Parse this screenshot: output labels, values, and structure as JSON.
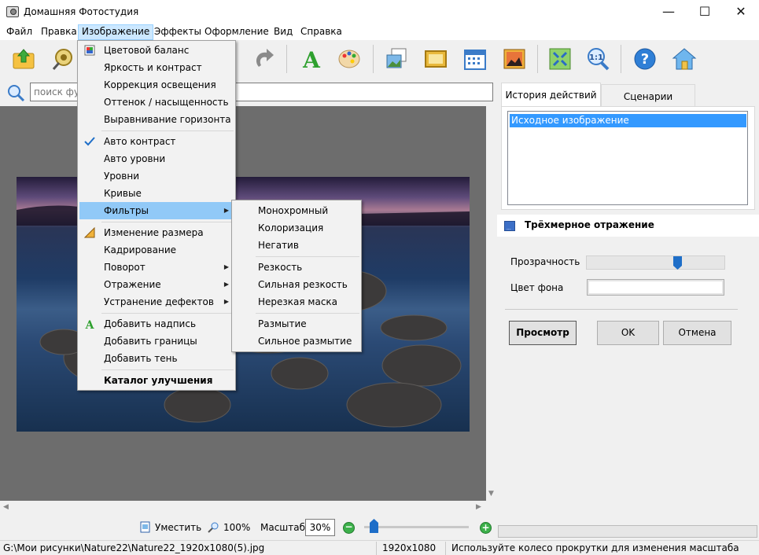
{
  "window": {
    "title": "Домашняя Фотостудия",
    "controls": [
      "—",
      "☐",
      "✕"
    ]
  },
  "menubar": [
    "Файл",
    "Правка",
    "Изображение",
    "Эффекты",
    "Оформление",
    "Вид",
    "Справка"
  ],
  "search": {
    "placeholder": "поиск фу"
  },
  "image_menu": {
    "items": [
      "Цветовой баланс",
      "Яркость и контраст",
      "Коррекция освещения",
      "Оттенок / насыщенность",
      "Выравнивание горизонта",
      "Авто контраст",
      "Авто уровни",
      "Уровни",
      "Кривые",
      "Фильтры",
      "Изменение размера",
      "Кадрирование",
      "Поворот",
      "Отражение",
      "Устранение дефектов",
      "Добавить надпись",
      "Добавить границы",
      "Добавить тень",
      "Каталог улучшения"
    ]
  },
  "filters_submenu": {
    "items": [
      "Монохромный",
      "Колоризация",
      "Негатив",
      "Резкость",
      "Сильная резкость",
      "Нерезкая маска",
      "Размытие",
      "Сильное размытие"
    ]
  },
  "right_panel": {
    "tabs": [
      "История действий",
      "Сценарии"
    ],
    "history": [
      "Исходное изображение"
    ],
    "effect_title": "Трёхмерное отражение",
    "transparency_label": "Прозрачность",
    "transparency_value": 0.67,
    "bgcolor_label": "Цвет фона",
    "preview_button": "Просмотр",
    "ok_button": "OK",
    "cancel_button": "Отмена"
  },
  "bottom": {
    "fit_label": "Уместить",
    "zoom100_label": "100%",
    "scale_label": "Масштаб:",
    "scale_value": "30%",
    "zoom_slider_value": 0.06
  },
  "status": {
    "path": "G:\\Мои рисунки\\Nature22\\Nature22_1920x1080(5).jpg",
    "size": "1920x1080",
    "hint": "Используйте колесо прокрутки для изменения масштаба"
  },
  "colors": {
    "menu_highlight": "#91c9f7",
    "selection": "#3399ff",
    "accent": "#1e6ec8"
  }
}
